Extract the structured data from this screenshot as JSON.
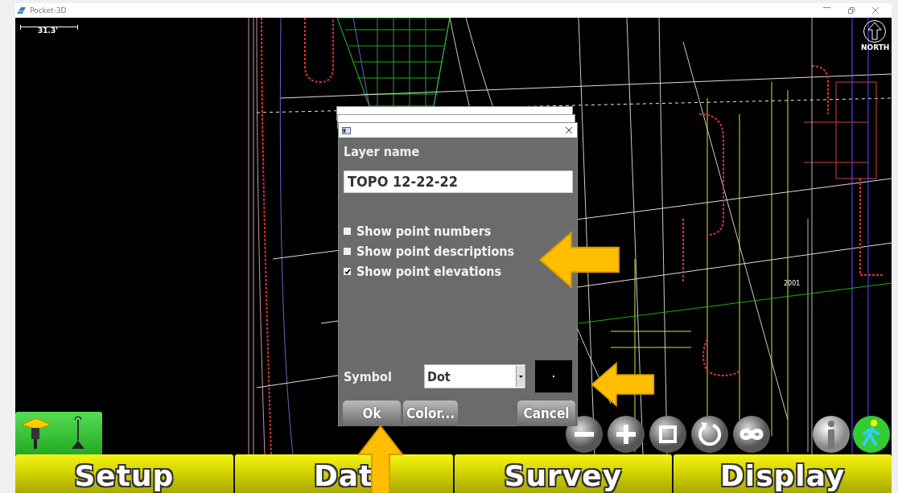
{
  "window": {
    "title": "Pocket-3D"
  },
  "map": {
    "scale_label": "31.3'",
    "north_label": "NORTH",
    "point_label": "2001"
  },
  "dialog": {
    "field_label": "Layer name",
    "layer_name": "TOPO 12-22-22",
    "checkboxes": [
      {
        "label": "Show point numbers",
        "checked": false
      },
      {
        "label": "Show point descriptions",
        "checked": false
      },
      {
        "label": "Show point elevations",
        "checked": true
      }
    ],
    "symbol_label": "Symbol",
    "symbol_value": "Dot",
    "buttons": [
      {
        "label": "Ok",
        "kind": "ok"
      },
      {
        "label": "Color...",
        "kind": "color"
      },
      {
        "label": "Cancel",
        "kind": "cancel"
      }
    ]
  },
  "map_tools": [
    {
      "kind": "minus"
    },
    {
      "kind": "plus"
    },
    {
      "kind": "square"
    },
    {
      "kind": "rotate"
    },
    {
      "kind": "infinity"
    }
  ],
  "tabs": [
    {
      "label": "Setup"
    },
    {
      "label": "Dat"
    },
    {
      "label": "Survey"
    },
    {
      "label": "Display"
    }
  ]
}
